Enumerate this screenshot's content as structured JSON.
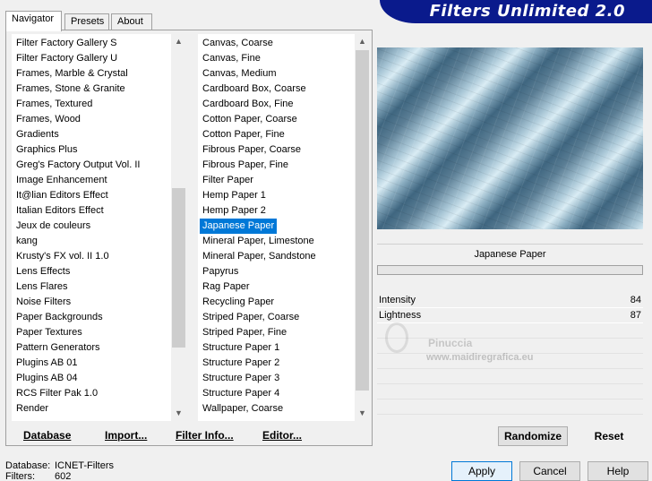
{
  "app": {
    "title": "Filters Unlimited 2.0"
  },
  "tabs": [
    {
      "label": "Navigator"
    },
    {
      "label": "Presets"
    },
    {
      "label": "About"
    }
  ],
  "categories": [
    "Filter Factory Gallery S",
    "Filter Factory Gallery U",
    "Frames, Marble & Crystal",
    "Frames, Stone & Granite",
    "Frames, Textured",
    "Frames, Wood",
    "Gradients",
    "Graphics Plus",
    "Greg's Factory Output Vol. II",
    "Image Enhancement",
    "It@lian Editors Effect",
    "Italian Editors Effect",
    "Jeux de couleurs",
    "kang",
    "Krusty's FX vol. II 1.0",
    "Lens Effects",
    "Lens Flares",
    "Noise Filters",
    "Paper Backgrounds",
    "Paper Textures",
    "Pattern Generators",
    "Plugins AB 01",
    "Plugins AB 04",
    "RCS Filter Pak 1.0",
    "Render"
  ],
  "filters": [
    "Canvas, Coarse",
    "Canvas, Fine",
    "Canvas, Medium",
    "Cardboard Box, Coarse",
    "Cardboard Box, Fine",
    "Cotton Paper, Coarse",
    "Cotton Paper, Fine",
    "Fibrous Paper, Coarse",
    "Fibrous Paper, Fine",
    "Filter Paper",
    "Hemp Paper 1",
    "Hemp Paper 2",
    "Japanese Paper",
    "Mineral Paper, Limestone",
    "Mineral Paper, Sandstone",
    "Papyrus",
    "Rag Paper",
    "Recycling Paper",
    "Striped Paper, Coarse",
    "Striped Paper, Fine",
    "Structure Paper 1",
    "Structure Paper 2",
    "Structure Paper 3",
    "Structure Paper 4",
    "Wallpaper, Coarse"
  ],
  "selected_filter_index": 12,
  "left_buttons": {
    "database": "Database",
    "import": "Import...",
    "filter_info": "Filter Info...",
    "editor": "Editor..."
  },
  "filter_name": "Japanese Paper",
  "parameters": [
    {
      "label": "Intensity",
      "value": "84"
    },
    {
      "label": "Lightness",
      "value": "87"
    }
  ],
  "right_buttons": {
    "randomize": "Randomize",
    "reset": "Reset"
  },
  "dialog_buttons": {
    "apply": "Apply",
    "cancel": "Cancel",
    "help": "Help"
  },
  "status": {
    "database_label": "Database:",
    "database_value": "ICNET-Filters",
    "filters_label": "Filters:",
    "filters_value": "602"
  },
  "watermark": {
    "name": "Pinuccia",
    "site": "www.maidiregrafica.eu"
  },
  "colors": {
    "banner": "#0a1a8c",
    "selection": "#0078d7"
  }
}
